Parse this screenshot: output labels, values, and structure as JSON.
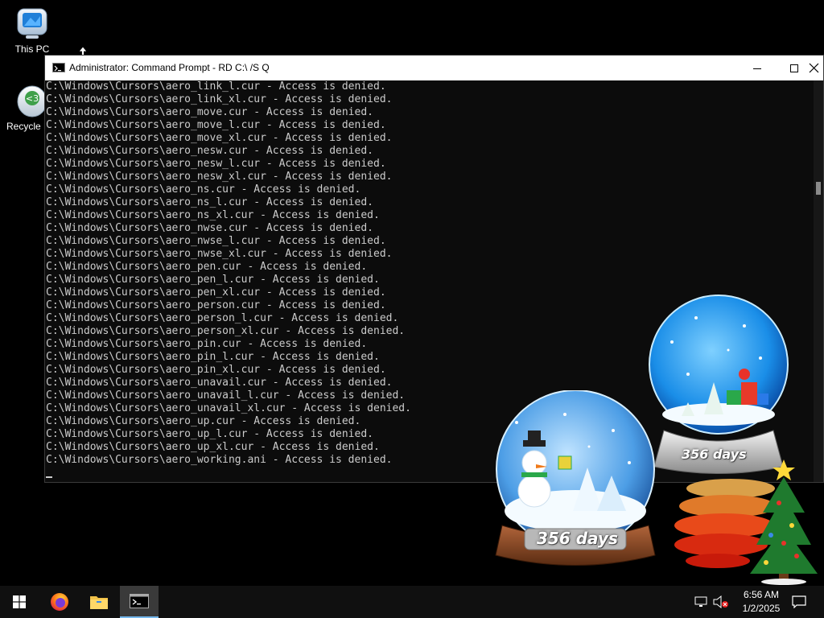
{
  "desktop": {
    "icons": [
      {
        "label": "This PC"
      },
      {
        "label": "Recycle Bin"
      }
    ]
  },
  "window": {
    "title": "Administrator: Command Prompt - RD  C:\\ /S Q",
    "console_lines": [
      "C:\\Windows\\Cursors\\aero_link_l.cur - Access is denied.",
      "C:\\Windows\\Cursors\\aero_link_xl.cur - Access is denied.",
      "C:\\Windows\\Cursors\\aero_move.cur - Access is denied.",
      "C:\\Windows\\Cursors\\aero_move_l.cur - Access is denied.",
      "C:\\Windows\\Cursors\\aero_move_xl.cur - Access is denied.",
      "C:\\Windows\\Cursors\\aero_nesw.cur - Access is denied.",
      "C:\\Windows\\Cursors\\aero_nesw_l.cur - Access is denied.",
      "C:\\Windows\\Cursors\\aero_nesw_xl.cur - Access is denied.",
      "C:\\Windows\\Cursors\\aero_ns.cur - Access is denied.",
      "C:\\Windows\\Cursors\\aero_ns_l.cur - Access is denied.",
      "C:\\Windows\\Cursors\\aero_ns_xl.cur - Access is denied.",
      "C:\\Windows\\Cursors\\aero_nwse.cur - Access is denied.",
      "C:\\Windows\\Cursors\\aero_nwse_l.cur - Access is denied.",
      "C:\\Windows\\Cursors\\aero_nwse_xl.cur - Access is denied.",
      "C:\\Windows\\Cursors\\aero_pen.cur - Access is denied.",
      "C:\\Windows\\Cursors\\aero_pen_l.cur - Access is denied.",
      "C:\\Windows\\Cursors\\aero_pen_xl.cur - Access is denied.",
      "C:\\Windows\\Cursors\\aero_person.cur - Access is denied.",
      "C:\\Windows\\Cursors\\aero_person_l.cur - Access is denied.",
      "C:\\Windows\\Cursors\\aero_person_xl.cur - Access is denied.",
      "C:\\Windows\\Cursors\\aero_pin.cur - Access is denied.",
      "C:\\Windows\\Cursors\\aero_pin_l.cur - Access is denied.",
      "C:\\Windows\\Cursors\\aero_pin_xl.cur - Access is denied.",
      "C:\\Windows\\Cursors\\aero_unavail.cur - Access is denied.",
      "C:\\Windows\\Cursors\\aero_unavail_l.cur - Access is denied.",
      "C:\\Windows\\Cursors\\aero_unavail_xl.cur - Access is denied.",
      "C:\\Windows\\Cursors\\aero_up.cur - Access is denied.",
      "C:\\Windows\\Cursors\\aero_up_l.cur - Access is denied.",
      "C:\\Windows\\Cursors\\aero_up_xl.cur - Access is denied.",
      "C:\\Windows\\Cursors\\aero_working.ani - Access is denied."
    ],
    "controls": [
      "minimize-icon",
      "maximize-icon",
      "close-icon"
    ]
  },
  "gadgets": {
    "globe_large_label": "356 days",
    "globe_small_label": "356 days"
  },
  "taskbar": {
    "apps": [
      "windows-start-icon",
      "firefox-icon",
      "file-explorer-icon",
      "command-prompt-icon"
    ],
    "time": "6:56 AM",
    "date": "1/2/2025"
  },
  "colors": {
    "console_bg": "#0c0c0c",
    "console_fg": "#cccccc",
    "taskbar_bg": "#101010",
    "titlebar_bg": "#ffffff"
  }
}
